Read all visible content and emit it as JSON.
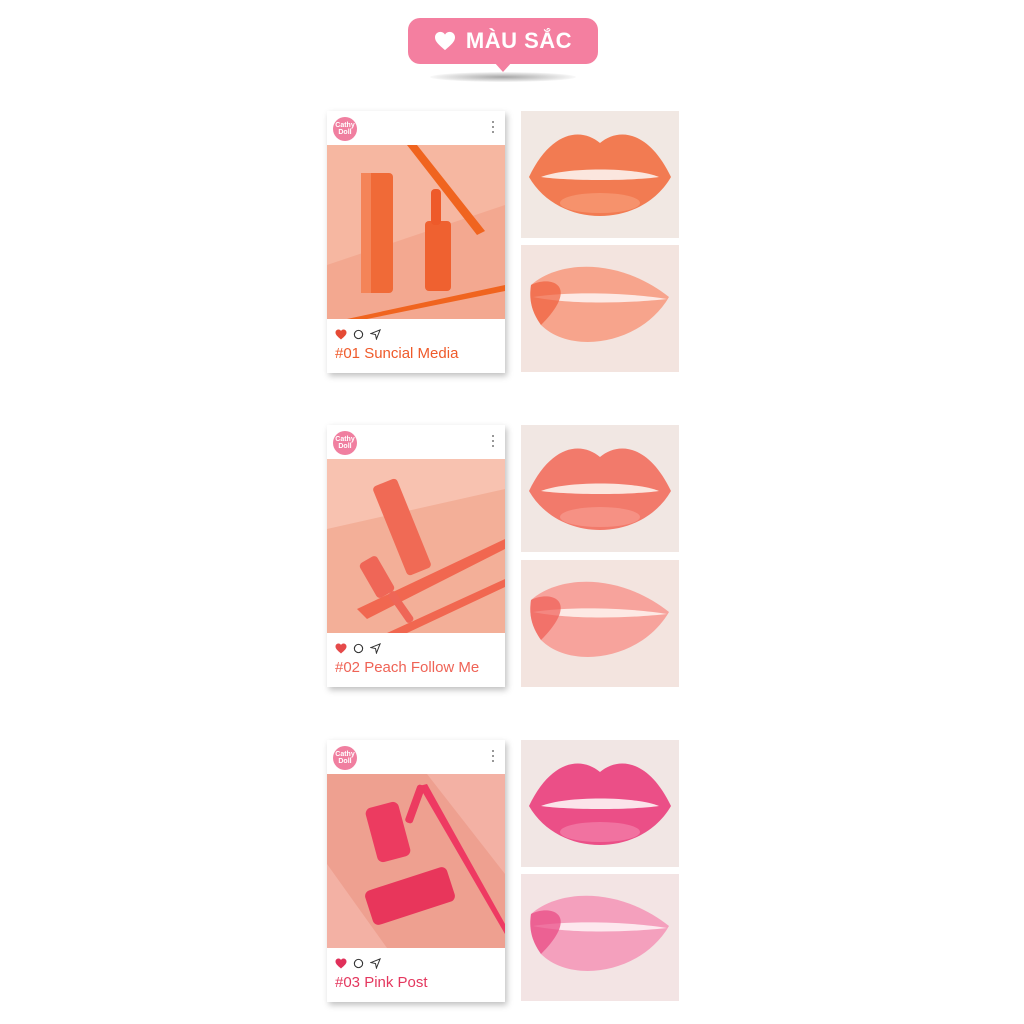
{
  "header": {
    "title": "MÀU SẮC",
    "color": "#f47fa0"
  },
  "brand": {
    "logo_text": "Cathy Doll"
  },
  "shades": [
    {
      "caption": "#01 Suncial Media",
      "color": "#ef5a2a",
      "bg": "#f7b9a4"
    },
    {
      "caption": "#02 Peach Follow Me",
      "color": "#ef6356",
      "bg": "#f8c0ae"
    },
    {
      "caption": "#03 Pink Post",
      "color": "#e4375e",
      "bg": "#f3b0a3"
    }
  ]
}
